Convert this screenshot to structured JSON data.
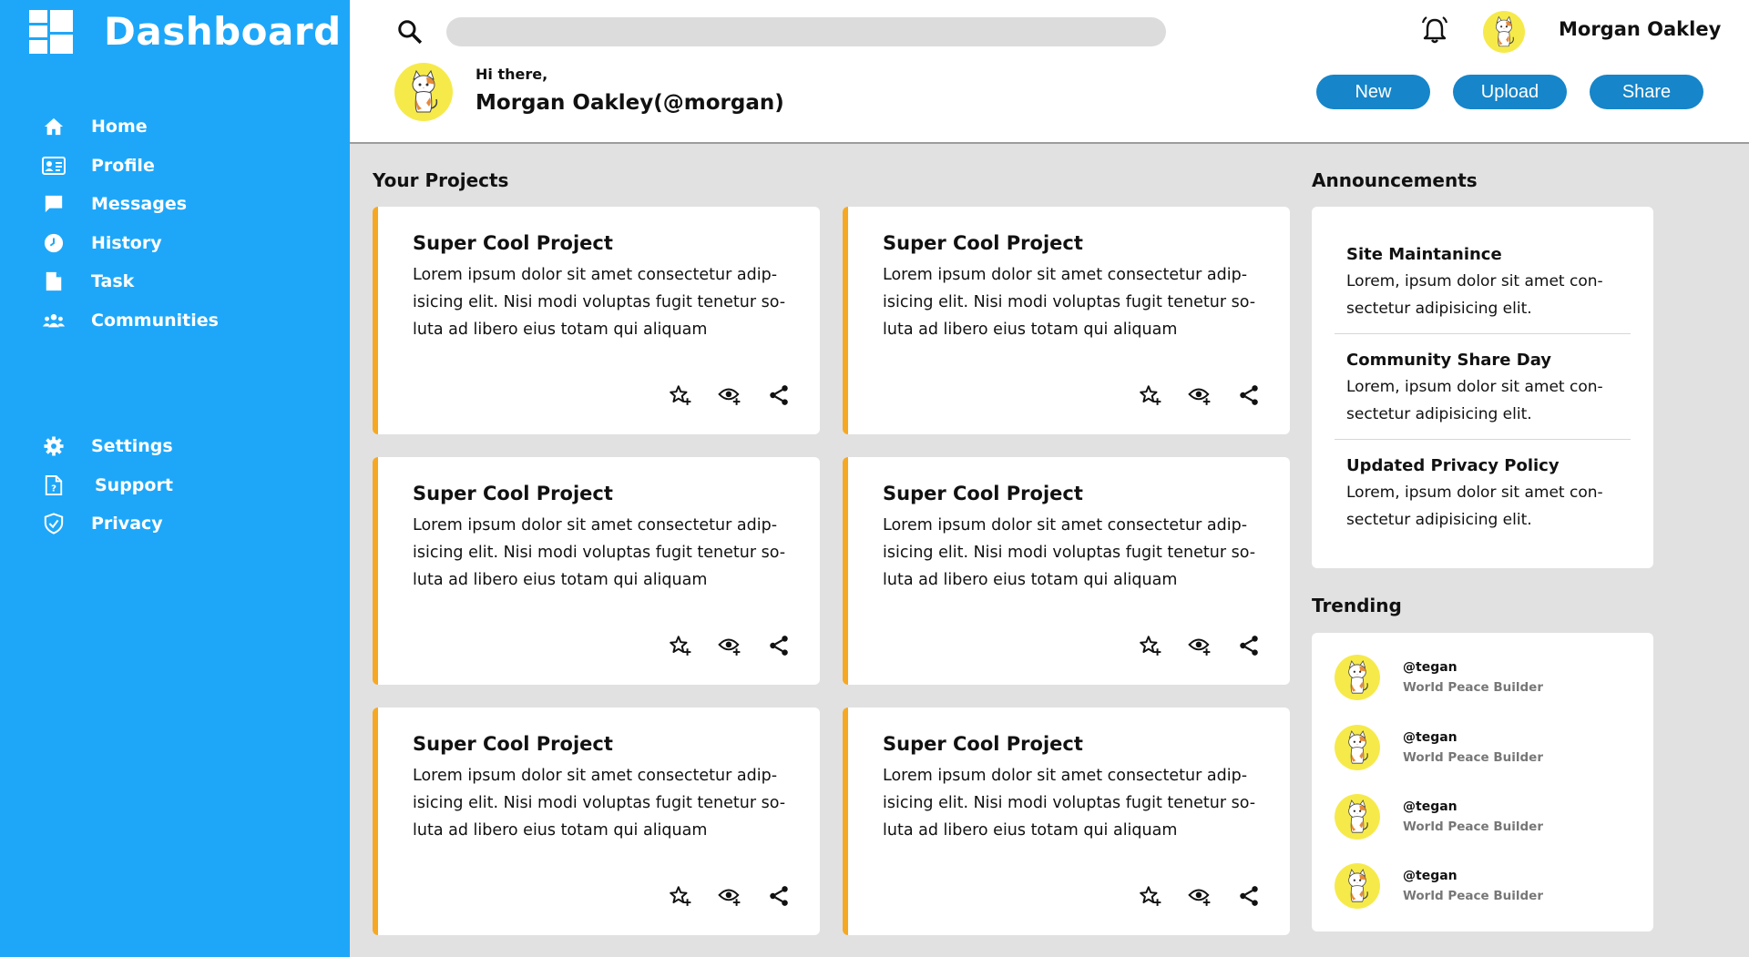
{
  "sidebar": {
    "title": "Dashboard",
    "nav_main": [
      {
        "label": "Home",
        "icon": "home-icon"
      },
      {
        "label": "Profile",
        "icon": "profile-card-icon"
      },
      {
        "label": "Messages",
        "icon": "message-icon"
      },
      {
        "label": "History",
        "icon": "clock-icon"
      },
      {
        "label": "Task",
        "icon": "document-icon"
      },
      {
        "label": "Communities",
        "icon": "people-icon"
      }
    ],
    "nav_bottom": [
      {
        "label": "Settings",
        "icon": "gear-icon"
      },
      {
        "label": "Support",
        "icon": "help-document-icon"
      },
      {
        "label": "Privacy",
        "icon": "shield-icon"
      }
    ]
  },
  "header": {
    "search_placeholder": "",
    "user_name": "Morgan Oakley",
    "greeting": "Hi there,",
    "full_name": "Morgan Oakley(@morgan)",
    "buttons": {
      "new": "New",
      "upload": "Upload",
      "share": "Share"
    }
  },
  "projects": {
    "title": "Your Projects",
    "items": [
      {
        "title": "Super Cool Project",
        "text": "Lorem ipsum dolor sit amet consectetur adip-isicing elit. Nisi modi voluptas fugit tenetur so-luta ad libero eius totam qui aliquam"
      },
      {
        "title": "Super Cool Project",
        "text": "Lorem ipsum dolor sit amet consectetur adip-isicing elit. Nisi modi voluptas fugit tenetur so-luta ad libero eius totam qui aliquam"
      },
      {
        "title": "Super Cool Project",
        "text": "Lorem ipsum dolor sit amet consectetur adip-isicing elit. Nisi modi voluptas fugit tenetur so-luta ad libero eius totam qui aliquam"
      },
      {
        "title": "Super Cool Project",
        "text": "Lorem ipsum dolor sit amet consectetur adip-isicing elit. Nisi modi voluptas fugit tenetur so-luta ad libero eius totam qui aliquam"
      },
      {
        "title": "Super Cool Project",
        "text": "Lorem ipsum dolor sit amet consectetur adip-isicing elit. Nisi modi voluptas fugit tenetur so-luta ad libero eius totam qui aliquam"
      },
      {
        "title": "Super Cool Project",
        "text": "Lorem ipsum dolor sit amet consectetur adip-isicing elit. Nisi modi voluptas fugit tenetur so-luta ad libero eius totam qui aliquam"
      }
    ]
  },
  "announcements": {
    "title": "Announcements",
    "items": [
      {
        "title": "Site Maintanince",
        "text": "Lorem, ipsum dolor sit amet con-sectetur adipisicing elit."
      },
      {
        "title": "Community Share Day",
        "text": "Lorem, ipsum dolor sit amet con-sectetur adipisicing elit."
      },
      {
        "title": "Updated Privacy Policy",
        "text": "Lorem, ipsum dolor sit amet con-sectetur adipisicing elit."
      }
    ]
  },
  "trending": {
    "title": "Trending",
    "items": [
      {
        "handle": "@tegan",
        "role": "World Peace Builder"
      },
      {
        "handle": "@tegan",
        "role": "World Peace Builder"
      },
      {
        "handle": "@tegan",
        "role": "World Peace Builder"
      },
      {
        "handle": "@tegan",
        "role": "World Peace Builder"
      }
    ]
  },
  "colors": {
    "sidebar": "#1ea7f9",
    "button": "#1685c9",
    "card_accent": "#f7a823",
    "background": "#e1e1e1",
    "avatar_bg": "#f5e94a"
  }
}
